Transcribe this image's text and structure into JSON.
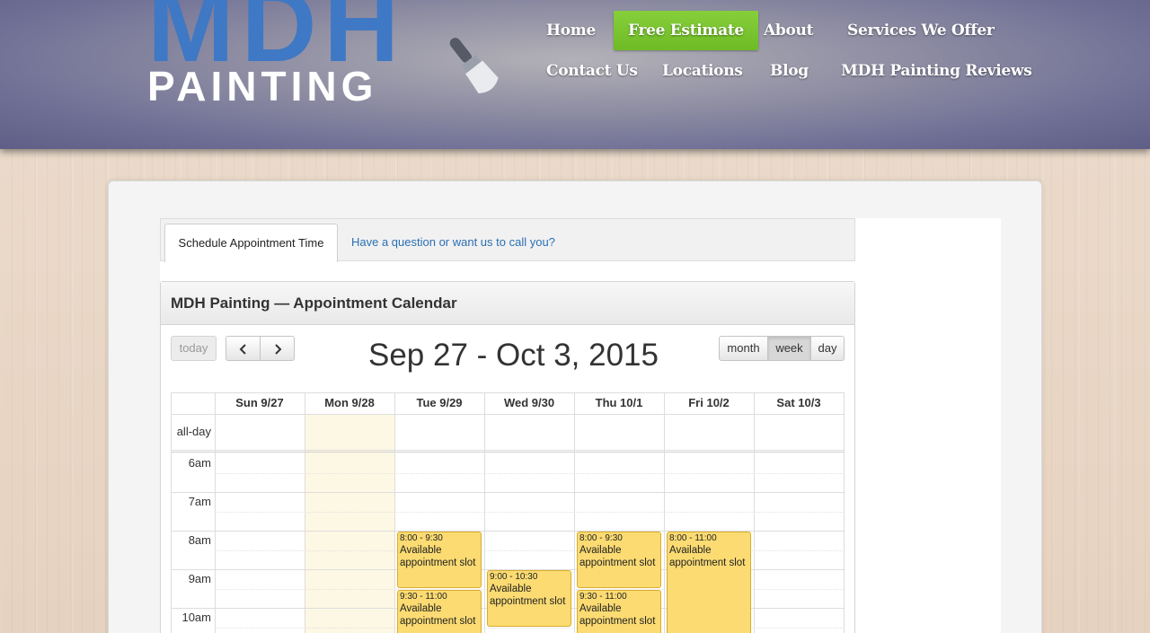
{
  "logo": {
    "line1": "MDH",
    "line2": "PAINTING"
  },
  "nav": {
    "items": [
      {
        "label": "Home"
      },
      {
        "label": "Free Estimate"
      },
      {
        "label": "About"
      },
      {
        "label": "Services We Offer"
      },
      {
        "label": "Contact Us"
      },
      {
        "label": "Locations"
      },
      {
        "label": "Blog"
      },
      {
        "label": "MDH Painting Reviews"
      }
    ]
  },
  "tabs": [
    {
      "label": "Schedule Appointment Time"
    },
    {
      "label": "Have a question or want us to call you?"
    }
  ],
  "calendar": {
    "title": "MDH Painting — Appointment Calendar",
    "today_label": "today",
    "prev_icon": "chevron-left-icon",
    "next_icon": "chevron-right-icon",
    "range": "Sep 27 - Oct 3, 2015",
    "views": [
      "month",
      "week",
      "day"
    ],
    "active_view": "week",
    "days": [
      "Sun 9/27",
      "Mon 9/28",
      "Tue 9/29",
      "Wed 9/30",
      "Thu 10/1",
      "Fri 10/2",
      "Sat 10/3"
    ],
    "today_day": "Mon 9/28",
    "allday_label": "all-day",
    "hours": [
      "6am",
      "7am",
      "8am",
      "9am",
      "10am"
    ],
    "events": [
      {
        "day": "Tue 9/29",
        "time": "8:00 - 9:30",
        "title": "Available appointment slot"
      },
      {
        "day": "Tue 9/29",
        "time": "9:30 - 11:00",
        "title": "Available appointment slot"
      },
      {
        "day": "Wed 9/30",
        "time": "9:00 - 10:30",
        "title": "Available appointment slot"
      },
      {
        "day": "Thu 10/1",
        "time": "8:00 - 9:30",
        "title": "Available appointment slot"
      },
      {
        "day": "Thu 10/1",
        "time": "9:30 - 11:00",
        "title": "Available appointment slot"
      },
      {
        "day": "Fri 10/2",
        "time": "8:00 - 11:00",
        "title": "Available appointment slot"
      }
    ]
  },
  "colors": {
    "nav_active": "#7ac431",
    "event_fill": "#fbdb72",
    "today_fill": "#fcf8e3",
    "link": "#2a6fb4"
  }
}
